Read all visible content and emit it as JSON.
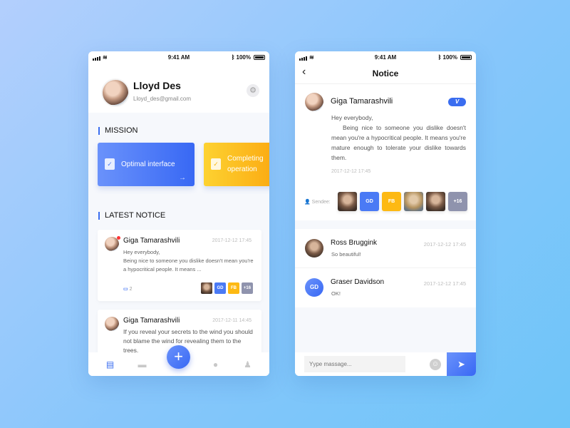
{
  "status_bar": {
    "time": "9:41 AM",
    "battery": "100%"
  },
  "profile": {
    "name": "Lloyd Des",
    "email": "Lloyd_des@gmail.com",
    "settings_icon": "gear-icon"
  },
  "mission": {
    "title": "MISSION",
    "cards": [
      {
        "label": "Optimal interface",
        "color": "#3f6ff5"
      },
      {
        "label": "Completing operation",
        "color": "#fbb11a"
      }
    ]
  },
  "latest_notice": {
    "title": "LATEST NOTICE",
    "items": [
      {
        "author": "Giga Tamarashvili",
        "date": "2017-12-12 17:45",
        "text": "Hey everybody,\n Being nice to someone you dislike doesn't mean you're a hypocritical people. It means ...",
        "comments": "2",
        "unread": true,
        "recipients": [
          "photo",
          "GD",
          "FB",
          "+16"
        ]
      },
      {
        "author": "Giga Tamarashvili",
        "date": "2017-12-11 14:45",
        "text": "If you reveal your secrets to the wind you should not blame the wind for revealing them to the trees."
      }
    ]
  },
  "tab_bar": {
    "tabs": [
      "notice",
      "folder",
      "add",
      "discover",
      "profile"
    ],
    "active": "notice",
    "fab_label": "+"
  },
  "notice_page": {
    "title": "Notice",
    "back_icon": "chevron-left-icon",
    "detail": {
      "author": "Giga Tamarashvili",
      "verified_badge": "V",
      "greeting": "Hey everybody,",
      "body": "Being nice to someone you dislike doesn't mean you're a hypocritical people. It means you're mature enough to tolerate your dislike towards them.",
      "date": "2017-12-12 17:45",
      "sendee_label": "Sendee:",
      "sendees": [
        "photo",
        "GD",
        "FB",
        "photo",
        "photo",
        "+16"
      ]
    },
    "comments": [
      {
        "name": "Ross Bruggink",
        "text": "So beautiful!",
        "date": "2017-12-12 17:45",
        "avatar": "photo"
      },
      {
        "name": "Graser Davidson",
        "text": "OK!",
        "date": "2017-12-12 17:45",
        "avatar": "GD"
      }
    ],
    "input": {
      "placeholder": "Yype massage...",
      "emoji_icon": "smiley-icon",
      "send_icon": "send-icon"
    }
  }
}
